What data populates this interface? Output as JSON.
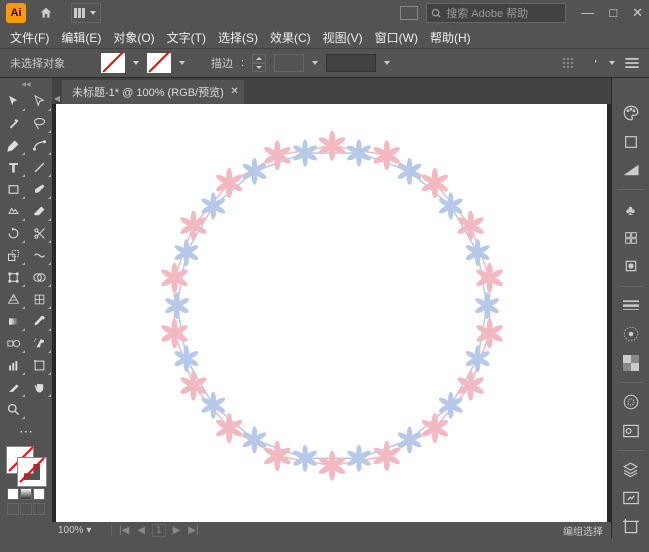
{
  "app": {
    "logo": "Ai"
  },
  "search": {
    "placeholder": "搜索 Adobe 帮助"
  },
  "menu": {
    "file": "文件(F)",
    "edit": "编辑(E)",
    "object": "对象(O)",
    "type": "文字(T)",
    "select": "选择(S)",
    "effect": "效果(C)",
    "view": "视图(V)",
    "window": "窗口(W)",
    "help": "帮助(H)"
  },
  "control": {
    "noSelection": "未选择对象",
    "strokeLabel": "描边"
  },
  "doc": {
    "tabTitle": "未标题-1* @ 100% (RGB/预览)"
  },
  "status": {
    "zoom": "100%",
    "artboard": "1",
    "mode": "编组选择"
  }
}
